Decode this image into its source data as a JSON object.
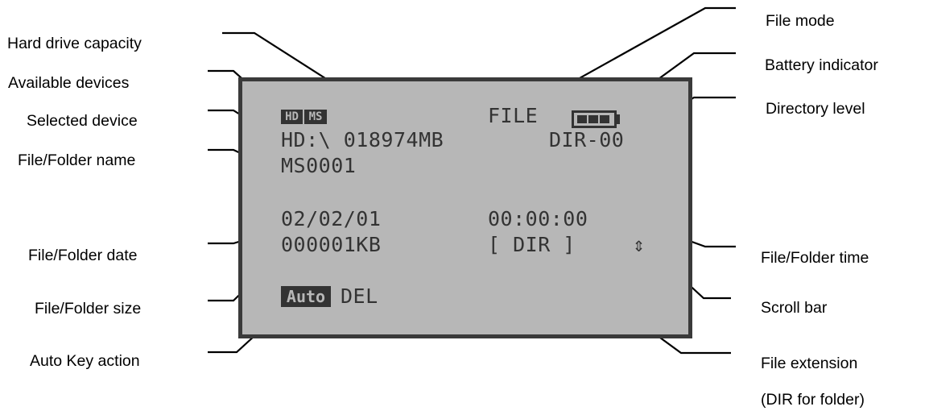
{
  "labels": {
    "hard_drive_capacity": "Hard drive capacity",
    "available_devices": "Available devices",
    "selected_device": "Selected device",
    "file_folder_name": "File/Folder name",
    "file_folder_date": "File/Folder date",
    "file_folder_size": "File/Folder size",
    "auto_key_action": "Auto Key action",
    "file_mode": "File mode",
    "battery_indicator": "Battery indicator",
    "directory_level": "Directory level",
    "file_folder_time": "File/Folder time",
    "scroll_bar": "Scroll bar",
    "file_extension": "File extension",
    "file_extension_note": "(DIR for folder)"
  },
  "lcd": {
    "device_hd": "HD",
    "device_ms": "MS",
    "mode": "FILE",
    "selected_path": "HD:\\ 018974MB",
    "dir_level": "DIR-00",
    "name": "MS0001",
    "date": "02/02/01",
    "time": "00:00:00",
    "size": "000001KB",
    "extension": "[ DIR ]",
    "scroll_glyph": "⇕",
    "auto_key": "Auto",
    "action": "DEL",
    "battery_level": 1.0
  },
  "colors": {
    "lcd_background": "#b7b7b7",
    "lcd_frame": "#3a3a3a",
    "lcd_ink": "#333333"
  }
}
